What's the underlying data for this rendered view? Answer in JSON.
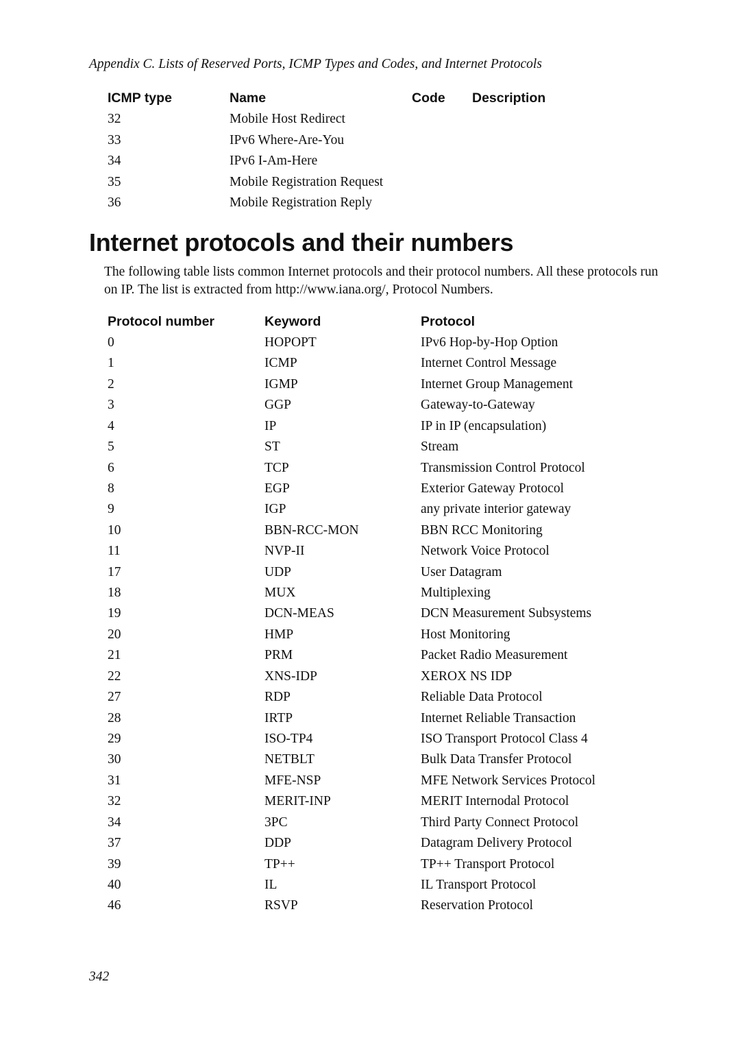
{
  "running_header": "Appendix C. Lists of Reserved Ports, ICMP Types and Codes, and Internet Protocols",
  "icmp_table": {
    "headers": [
      "ICMP type",
      "Name",
      "Code",
      "Description"
    ],
    "rows": [
      {
        "type": "32",
        "name": "Mobile Host Redirect"
      },
      {
        "type": "33",
        "name": "IPv6 Where-Are-You"
      },
      {
        "type": "34",
        "name": "IPv6 I-Am-Here"
      },
      {
        "type": "35",
        "name": "Mobile Registration Request"
      },
      {
        "type": "36",
        "name": "Mobile Registration Reply"
      }
    ]
  },
  "section": {
    "title": "Internet protocols and their numbers",
    "intro": "The following table lists common Internet protocols and their protocol numbers. All these protocols run on IP. The list is extracted from http://www.iana.org/, Protocol Numbers."
  },
  "protocol_table": {
    "headers": [
      "Protocol number",
      "Keyword",
      "Protocol"
    ],
    "rows": [
      {
        "number": "0",
        "keyword": "HOPOPT",
        "protocol": "IPv6 Hop-by-Hop Option"
      },
      {
        "number": "1",
        "keyword": "ICMP",
        "protocol": "Internet Control Message"
      },
      {
        "number": "2",
        "keyword": "IGMP",
        "protocol": "Internet Group Management"
      },
      {
        "number": "3",
        "keyword": "GGP",
        "protocol": "Gateway-to-Gateway"
      },
      {
        "number": "4",
        "keyword": "IP",
        "protocol": "IP in IP (encapsulation)"
      },
      {
        "number": "5",
        "keyword": "ST",
        "protocol": "Stream"
      },
      {
        "number": "6",
        "keyword": "TCP",
        "protocol": "Transmission Control Protocol"
      },
      {
        "number": "8",
        "keyword": "EGP",
        "protocol": "Exterior Gateway Protocol"
      },
      {
        "number": "9",
        "keyword": "IGP",
        "protocol": "any private interior gateway"
      },
      {
        "number": "10",
        "keyword": "BBN-RCC-MON",
        "protocol": "BBN RCC Monitoring"
      },
      {
        "number": "11",
        "keyword": "NVP-II",
        "protocol": "Network Voice Protocol"
      },
      {
        "number": "17",
        "keyword": "UDP",
        "protocol": "User Datagram"
      },
      {
        "number": "18",
        "keyword": "MUX",
        "protocol": "Multiplexing"
      },
      {
        "number": "19",
        "keyword": "DCN-MEAS",
        "protocol": "DCN Measurement Subsystems"
      },
      {
        "number": "20",
        "keyword": "HMP",
        "protocol": "Host Monitoring"
      },
      {
        "number": "21",
        "keyword": "PRM",
        "protocol": "Packet Radio Measurement"
      },
      {
        "number": "22",
        "keyword": "XNS-IDP",
        "protocol": "XEROX NS IDP"
      },
      {
        "number": "27",
        "keyword": "RDP",
        "protocol": "Reliable Data Protocol"
      },
      {
        "number": "28",
        "keyword": "IRTP",
        "protocol": "Internet Reliable Transaction"
      },
      {
        "number": "29",
        "keyword": "ISO-TP4",
        "protocol": "ISO Transport Protocol Class 4"
      },
      {
        "number": "30",
        "keyword": "NETBLT",
        "protocol": "Bulk Data Transfer Protocol"
      },
      {
        "number": "31",
        "keyword": "MFE-NSP",
        "protocol": "MFE Network Services Protocol"
      },
      {
        "number": "32",
        "keyword": "MERIT-INP",
        "protocol": "MERIT Internodal Protocol"
      },
      {
        "number": "34",
        "keyword": "3PC",
        "protocol": "Third Party Connect Protocol"
      },
      {
        "number": "37",
        "keyword": "DDP",
        "protocol": "Datagram Delivery Protocol"
      },
      {
        "number": "39",
        "keyword": "TP++",
        "protocol": "TP++ Transport Protocol"
      },
      {
        "number": "40",
        "keyword": "IL",
        "protocol": "IL Transport Protocol"
      },
      {
        "number": "46",
        "keyword": "RSVP",
        "protocol": "Reservation Protocol"
      }
    ]
  },
  "page_number": "342"
}
